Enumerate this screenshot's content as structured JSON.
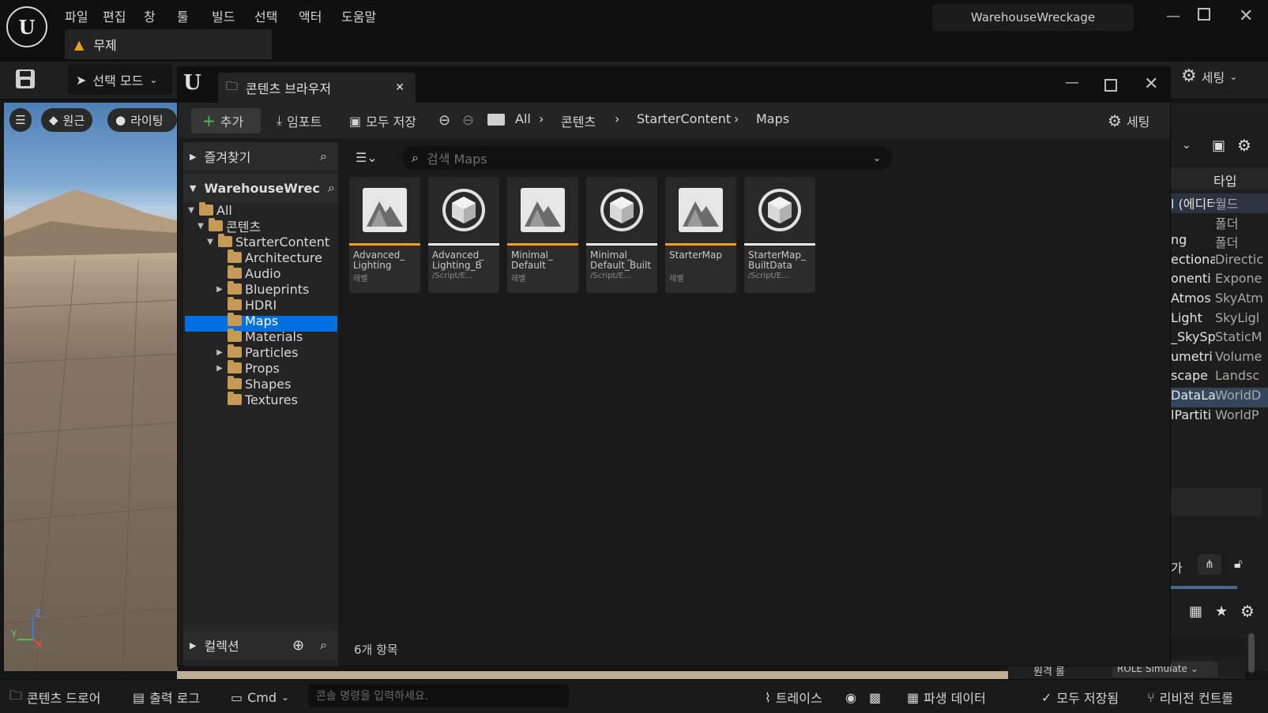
{
  "menu": [
    "파일",
    "편집",
    "창",
    "툴",
    "빌드",
    "선택",
    "액터",
    "도움말"
  ],
  "project_name": "WarehouseWreckage",
  "doc_tab": "무제",
  "select_mode": "선택 모드",
  "top_settings": "세팅",
  "viewport": {
    "perspective": "원근",
    "lit": "라이팅"
  },
  "content_browser": {
    "tab": "콘텐츠 브라우저",
    "add": "추가",
    "import": "임포트",
    "save_all": "모두 저장",
    "crumbs": [
      "All",
      "콘텐츠",
      "StarterContent",
      "Maps"
    ],
    "settings": "세팅",
    "favorites": "즐겨찾기",
    "project_root": "WarehouseWrec",
    "search_placeholder": "검색 Maps",
    "collections": "컬렉션",
    "item_count": "6개 항목",
    "tree": [
      {
        "label": "All",
        "depth": 0,
        "arrow": "open"
      },
      {
        "label": "콘텐츠",
        "depth": 1,
        "arrow": "open"
      },
      {
        "label": "StarterContent",
        "depth": 2,
        "arrow": "open"
      },
      {
        "label": "Architecture",
        "depth": 3,
        "arrow": ""
      },
      {
        "label": "Audio",
        "depth": 3,
        "arrow": ""
      },
      {
        "label": "Blueprints",
        "depth": 3,
        "arrow": "closed"
      },
      {
        "label": "HDRI",
        "depth": 3,
        "arrow": ""
      },
      {
        "label": "Maps",
        "depth": 3,
        "arrow": "",
        "selected": true
      },
      {
        "label": "Materials",
        "depth": 3,
        "arrow": ""
      },
      {
        "label": "Particles",
        "depth": 3,
        "arrow": "closed"
      },
      {
        "label": "Props",
        "depth": 3,
        "arrow": "closed"
      },
      {
        "label": "Shapes",
        "depth": 3,
        "arrow": ""
      },
      {
        "label": "Textures",
        "depth": 3,
        "arrow": ""
      }
    ],
    "assets": [
      {
        "name": "Advanced_ Lighting",
        "type": "레벨",
        "kind": "level",
        "color": "#f0a020"
      },
      {
        "name": "Advanced_ Lighting_B",
        "type": "/Script/E...",
        "kind": "data",
        "color": "#e8e8e8"
      },
      {
        "name": "Minimal_ Default",
        "type": "레벨",
        "kind": "level",
        "color": "#f0a020"
      },
      {
        "name": "Minimal_ Default_Built",
        "type": "/Script/E...",
        "kind": "data",
        "color": "#e8e8e8"
      },
      {
        "name": "StarterMap",
        "type": "레벨",
        "kind": "level",
        "color": "#f0a020"
      },
      {
        "name": "StarterMap_ BuiltData",
        "type": "/Script/E...",
        "kind": "data",
        "color": "#e8e8e8"
      }
    ]
  },
  "outliner": {
    "type_header": "타입",
    "rows": [
      {
        "name": "l (에디터",
        "type": "월드"
      },
      {
        "name": "",
        "type": "폴더"
      },
      {
        "name": "ng",
        "type": "폴더"
      },
      {
        "name": "ectiona",
        "type": "Directic"
      },
      {
        "name": "onenti",
        "type": "Expone"
      },
      {
        "name": "Atmos",
        "type": "SkyAtm"
      },
      {
        "name": "Light",
        "type": "SkyLigl"
      },
      {
        "name": "_SkySp",
        "type": "StaticM"
      },
      {
        "name": "umetri",
        "type": "Volume"
      },
      {
        "name": "scape",
        "type": "Landsc"
      },
      {
        "name": "DataLa",
        "type": "WorldD"
      },
      {
        "name": "lPartiti",
        "type": "WorldP"
      }
    ],
    "detail_label": "원격 롤",
    "detail_value": "ROLE Simulate",
    "partial_btn": "가"
  },
  "bottom": {
    "drawer": "콘텐츠 드로어",
    "output": "출력 로그",
    "cmd": "Cmd",
    "cmd_placeholder": "콘솔 명령을 입력하세요.",
    "trace": "트레이스",
    "derived": "파생 데이터",
    "saved": "모두 저장됨",
    "revision": "리비전 컨트롤"
  },
  "axes": {
    "z": "Z",
    "y": "Y",
    "x": "X"
  }
}
